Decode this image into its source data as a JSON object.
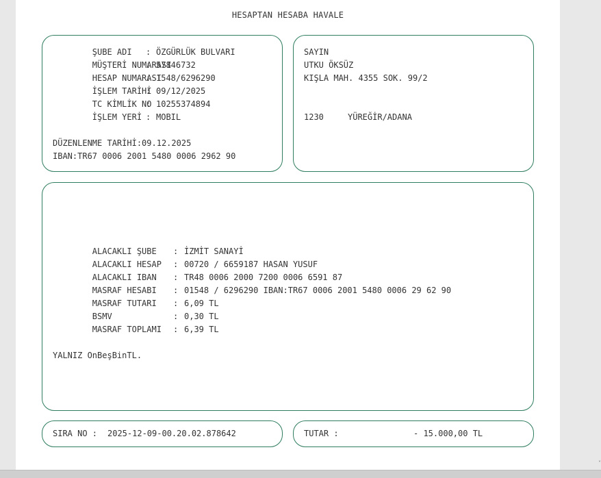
{
  "document": {
    "title": "HESAPTAN HESABA HAVALE"
  },
  "branch_info": {
    "rows": [
      {
        "label": "ŞUBE ADI",
        "value": "ÖZGÜRLÜK BULVARI"
      },
      {
        "label": "MÜŞTERİ NUMARASI",
        "value": "57846732"
      },
      {
        "label": "HESAP NUMARASI",
        "value": "1548/6296290"
      },
      {
        "label": "İŞLEM TARİHİ",
        "value": "09/12/2025"
      },
      {
        "label": "TC KİMLİK NO",
        "value": "10255374894"
      },
      {
        "label": "İŞLEM YERİ",
        "value": "MOBIL"
      }
    ],
    "issue_date": "DÜZENLENME TARİHİ:09.12.2025",
    "iban": "IBAN:TR67 0006 2001 5480 0006 2962 90"
  },
  "recipient_address": {
    "salutation": "SAYIN",
    "name": "UTKU ÖKSÜZ",
    "street": "KIŞLA MAH. 4355 SOK. 99/2",
    "postal_code": "1230",
    "city": "YÜREĞİR/ADANA"
  },
  "transfer_details": {
    "rows": [
      {
        "label": "ALACAKLI ŞUBE",
        "value": "İZMİT SANAYİ"
      },
      {
        "label": "ALACAKLI HESAP",
        "value": "00720 / 6659187 HASAN YUSUF"
      },
      {
        "label": "ALACAKLI IBAN",
        "value": "TR48 0006 2000 7200 0006 6591 87"
      },
      {
        "label": "MASRAF HESABI",
        "value": "01548 / 6296290 IBAN:TR67 0006 2001 5480 0006 29 62 90"
      },
      {
        "label": "MASRAF TUTARI",
        "value": "6,09 TL"
      },
      {
        "label": "BSMV",
        "value": "0,30 TL"
      },
      {
        "label": "MASRAF TOPLAMI",
        "value": "6,39 TL"
      }
    ],
    "amount_in_words": "YALNIZ OnBeşBinTL."
  },
  "footer": {
    "sequence_label": "SIRA NO :",
    "sequence_value": "2025-12-09-00.20.02.878642",
    "amount_label": "TUTAR :",
    "amount_value": "- 15.000,00 TL"
  },
  "separator": ":",
  "colors": {
    "border": "#2e7d5e",
    "text": "#333333"
  }
}
